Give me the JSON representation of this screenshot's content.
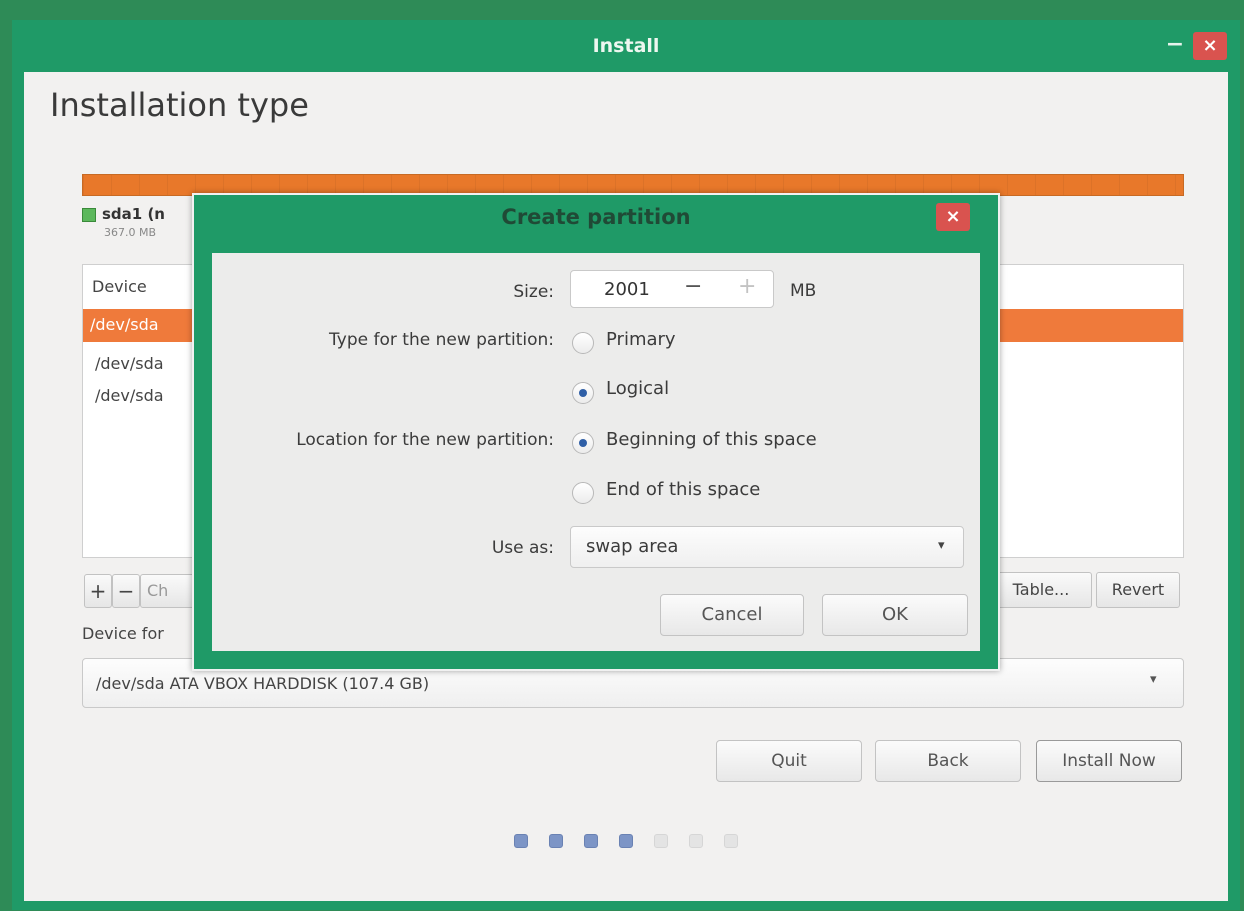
{
  "window": {
    "title": "Install",
    "minimize": "−",
    "close": "×"
  },
  "page": {
    "title": "Installation type"
  },
  "legend": {
    "name": "sda1 (n",
    "size": "367.0 MB"
  },
  "table": {
    "column_device": "Device",
    "rows": [
      "/dev/sda",
      "/dev/sda",
      "/dev/sda"
    ]
  },
  "toolbar": {
    "add": "+",
    "remove": "−",
    "change": "Ch",
    "new_table": "Table...",
    "revert": "Revert"
  },
  "bootloader": {
    "label": "Device for",
    "value": "/dev/sda   ATA VBOX HARDDISK (107.4 GB)",
    "arrow": "▾"
  },
  "buttons": {
    "quit": "Quit",
    "back": "Back",
    "install_now": "Install Now"
  },
  "progress": {
    "total_steps": 7,
    "completed_steps": 4
  },
  "dialog": {
    "title": "Create partition",
    "close": "×",
    "size_label": "Size:",
    "size_value": "2001",
    "size_minus": "−",
    "size_plus": "+",
    "size_unit": "MB",
    "type_label": "Type for the new partition:",
    "type_options": [
      "Primary",
      "Logical"
    ],
    "type_selected": "Logical",
    "location_label": "Location for the new partition:",
    "location_options": [
      "Beginning of this space",
      "End of this space"
    ],
    "location_selected": "Beginning of this space",
    "use_as_label": "Use as:",
    "use_as_value": "swap area",
    "use_as_arrow": "▾",
    "cancel": "Cancel",
    "ok": "OK"
  },
  "colors": {
    "accent": "#1f9a67",
    "selection": "#ef7a3b",
    "close": "#d9534f",
    "radio_dot": "#2f5fa6"
  }
}
